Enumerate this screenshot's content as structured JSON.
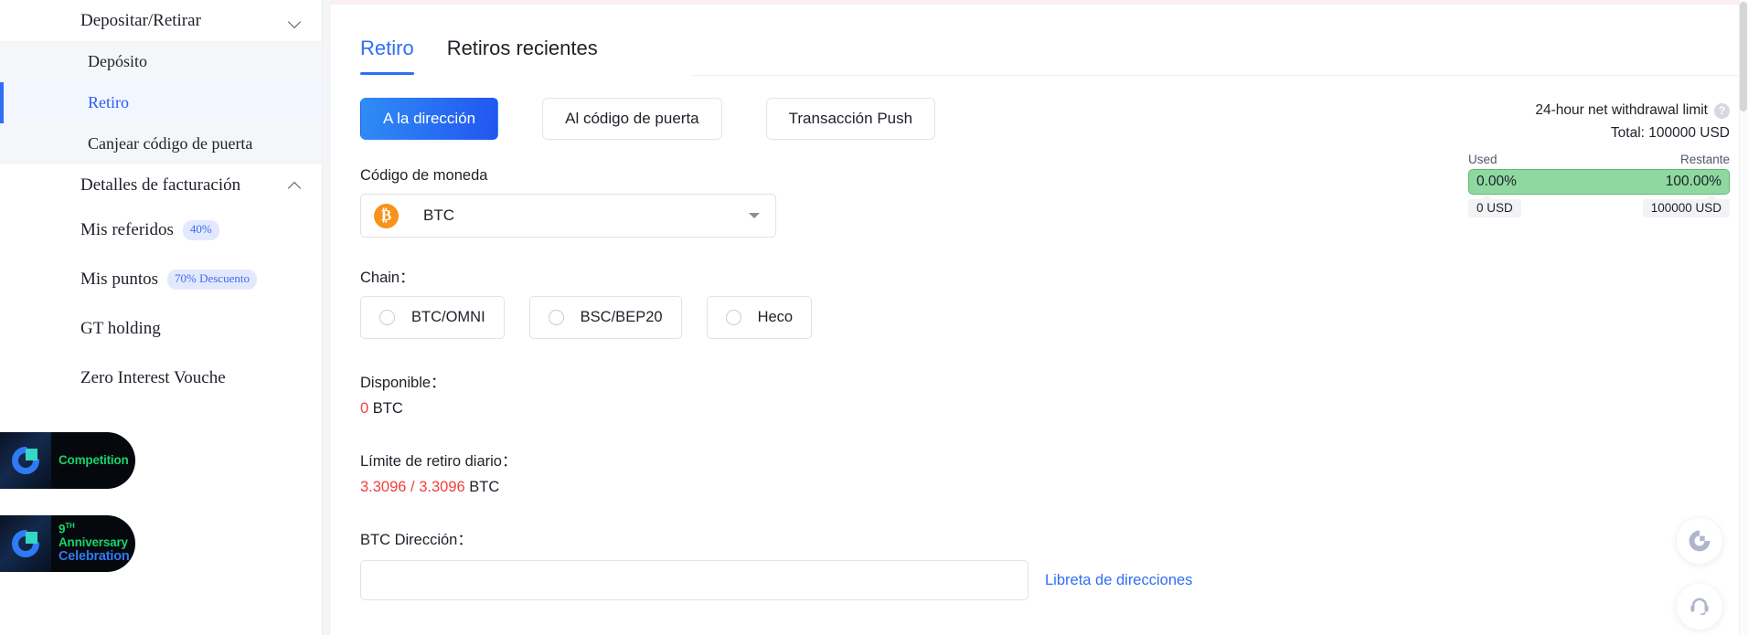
{
  "sidebar": {
    "groups": [
      {
        "label": "Depositar/Retirar",
        "chevron": "chevron-down-icon",
        "items": [
          {
            "label": "Depósito",
            "active": false
          },
          {
            "label": "Retiro",
            "active": true
          },
          {
            "label": "Canjear código de puerta",
            "active": false
          }
        ]
      },
      {
        "label": "Detalles de facturación",
        "chevron": "chevron-up-icon"
      }
    ],
    "items": [
      {
        "label": "Mis referidos",
        "badge": "40%"
      },
      {
        "label": "Mis puntos",
        "badge": "70% Descuento"
      },
      {
        "label": "GT holding",
        "badge": ""
      },
      {
        "label": "Zero Interest Vouche",
        "badge": ""
      }
    ],
    "promos": [
      {
        "line1": "Competition",
        "line2": "",
        "sup": ""
      },
      {
        "line1": "Anniversary",
        "line2": "Celebration",
        "prefix": "9",
        "sup": "TH"
      }
    ]
  },
  "main": {
    "tabs": [
      {
        "label": "Retiro",
        "active": true
      },
      {
        "label": "Retiros recientes",
        "active": false
      }
    ],
    "methods": [
      {
        "label": "A la dirección",
        "primary": true
      },
      {
        "label": "Al código de puerta",
        "primary": false
      },
      {
        "label": "Transacción Push",
        "primary": false
      }
    ],
    "currency": {
      "label": "Código de moneda",
      "icon": "bitcoin-icon",
      "symbol": "₿",
      "value": "BTC",
      "icon_color": "#f7931a"
    },
    "chain": {
      "label": "Chain：",
      "options": [
        {
          "label": "BTC/OMNI",
          "selected": false
        },
        {
          "label": "BSC/BEP20",
          "selected": false
        },
        {
          "label": "Heco",
          "selected": false
        }
      ]
    },
    "available": {
      "label": "Disponible：",
      "amount": "0",
      "unit": "BTC"
    },
    "daily_limit": {
      "label": "Límite de retiro diario：",
      "amount": "3.3096 / 3.3096",
      "unit": "BTC"
    },
    "address": {
      "label": "BTC Dirección：",
      "value": "",
      "placeholder": "",
      "book_link": "Libreta de direcciones"
    }
  },
  "limit_panel": {
    "title": "24-hour net withdrawal limit",
    "help_icon": "question-mark-icon",
    "help_glyph": "?",
    "total": "Total: 100000 USD",
    "used_label": "Used",
    "remaining_label": "Restante",
    "used_pct": "0.00%",
    "remaining_pct": "100.00%",
    "used_amount": "0 USD",
    "remaining_amount": "100000 USD",
    "bar_color": "#8fd9a0"
  },
  "floating": [
    {
      "name": "gate-logo-icon"
    },
    {
      "name": "headset-support-icon"
    }
  ],
  "colors": {
    "accent": "#2f6ef5",
    "danger": "#f53f3f",
    "green": "#8fd9a0",
    "bitcoin": "#f7931a"
  }
}
